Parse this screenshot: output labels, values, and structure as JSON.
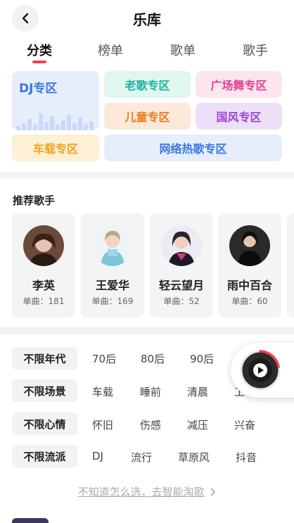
{
  "header": {
    "title": "乐库"
  },
  "tabs": [
    {
      "label": "分类"
    },
    {
      "label": "榜单"
    },
    {
      "label": "歌单"
    },
    {
      "label": "歌手"
    }
  ],
  "categories": [
    {
      "label": "DJ专区",
      "color": "#3a76e0",
      "bg": "#e6eefc"
    },
    {
      "label": "老歌专区",
      "color": "#1fb39a",
      "bg": "#dff6f1"
    },
    {
      "label": "广场舞专区",
      "color": "#e2418f",
      "bg": "#fce5ef"
    },
    {
      "label": "儿童专区",
      "color": "#f07a1f",
      "bg": "#fde9da"
    },
    {
      "label": "国风专区",
      "color": "#9a45d8",
      "bg": "#eedff8"
    },
    {
      "label": "车载专区",
      "color": "#f0a31b",
      "bg": "#fdf0d5"
    },
    {
      "label": "网络热歌专区",
      "color": "#3a76e0",
      "bg": "#e6eefc"
    }
  ],
  "recommended": {
    "title": "推荐歌手",
    "singers": [
      {
        "name": "李英",
        "count": "单曲：181"
      },
      {
        "name": "王爱华",
        "count": "单曲：169"
      },
      {
        "name": "轻云望月",
        "count": "单曲：52"
      },
      {
        "name": "雨中百合",
        "count": "单曲：60"
      }
    ]
  },
  "filters": [
    {
      "label": "不限年代",
      "options": [
        "70后",
        "80后",
        "90后"
      ]
    },
    {
      "label": "不限场景",
      "options": [
        "车载",
        "睡前",
        "清晨",
        "工"
      ]
    },
    {
      "label": "不限心情",
      "options": [
        "怀旧",
        "伤感",
        "减压",
        "兴奋"
      ]
    },
    {
      "label": "不限流派",
      "options": [
        "DJ",
        "流行",
        "草原风",
        "抖音"
      ]
    }
  ],
  "smart_link": "不知道怎么选，去智能淘歌",
  "accent_color": "#f23f4d"
}
